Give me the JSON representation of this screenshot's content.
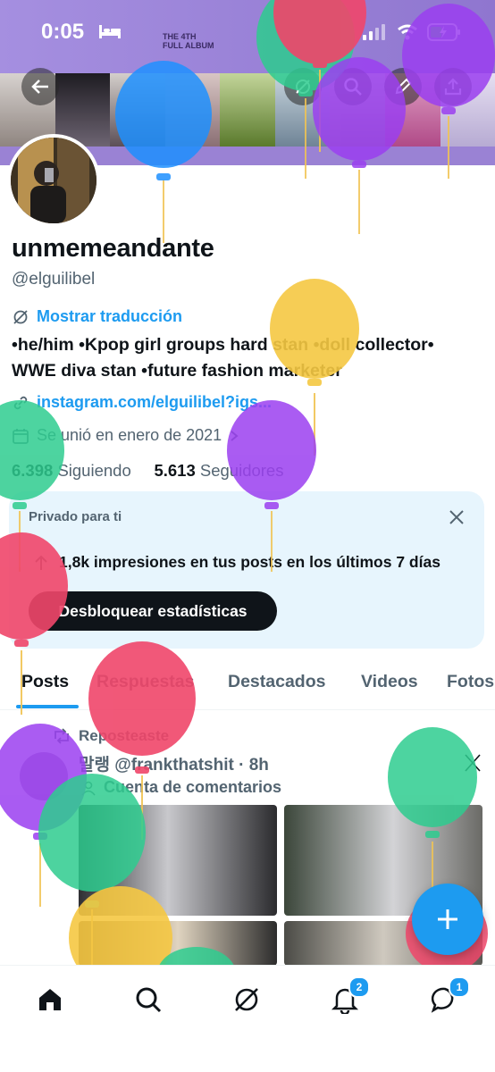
{
  "status_bar": {
    "time": "0:05"
  },
  "banner": {
    "album_line1": "THE 4TH",
    "album_line2": "FULL ALBUM"
  },
  "profile": {
    "display_name": "unmemeandante",
    "handle": "@elguilibel",
    "translate_label": "Mostrar traducción",
    "bio_line1": "•he/him •Kpop girl groups hard stan •doll collector•",
    "bio_line2": "WWE diva stan •future fashion marketer",
    "link": "instagram.com/elguilibel?igs...",
    "joined": "Se unió en enero de 2021",
    "following_count": "6.398",
    "following_label": "Siguiendo",
    "followers_count": "5.613",
    "followers_label": "Seguidores"
  },
  "stats_card": {
    "title": "Privado para ti",
    "impressions": "1,8k impresiones en tus posts en los últimos 7 días",
    "button": "Desbloquear estadísticas"
  },
  "tabs": [
    "Posts",
    "Respuestas",
    "Destacados",
    "Videos",
    "Fotos"
  ],
  "post": {
    "repost_label": "Reposteaste",
    "author": "말랭 @frankthatshit · 8h",
    "community": "Cuenta de comentarios"
  },
  "nav": {
    "notifications_badge": "2",
    "messages_badge": "1"
  },
  "colors": {
    "accent": "#1d9bf0",
    "banner": "#9d84d6",
    "card_bg": "#e7f5fd"
  },
  "icons": [
    "back-arrow-icon",
    "grok-icon",
    "search-icon",
    "pencil-icon",
    "share-icon",
    "home-icon",
    "bell-icon",
    "message-icon",
    "plus-icon"
  ]
}
